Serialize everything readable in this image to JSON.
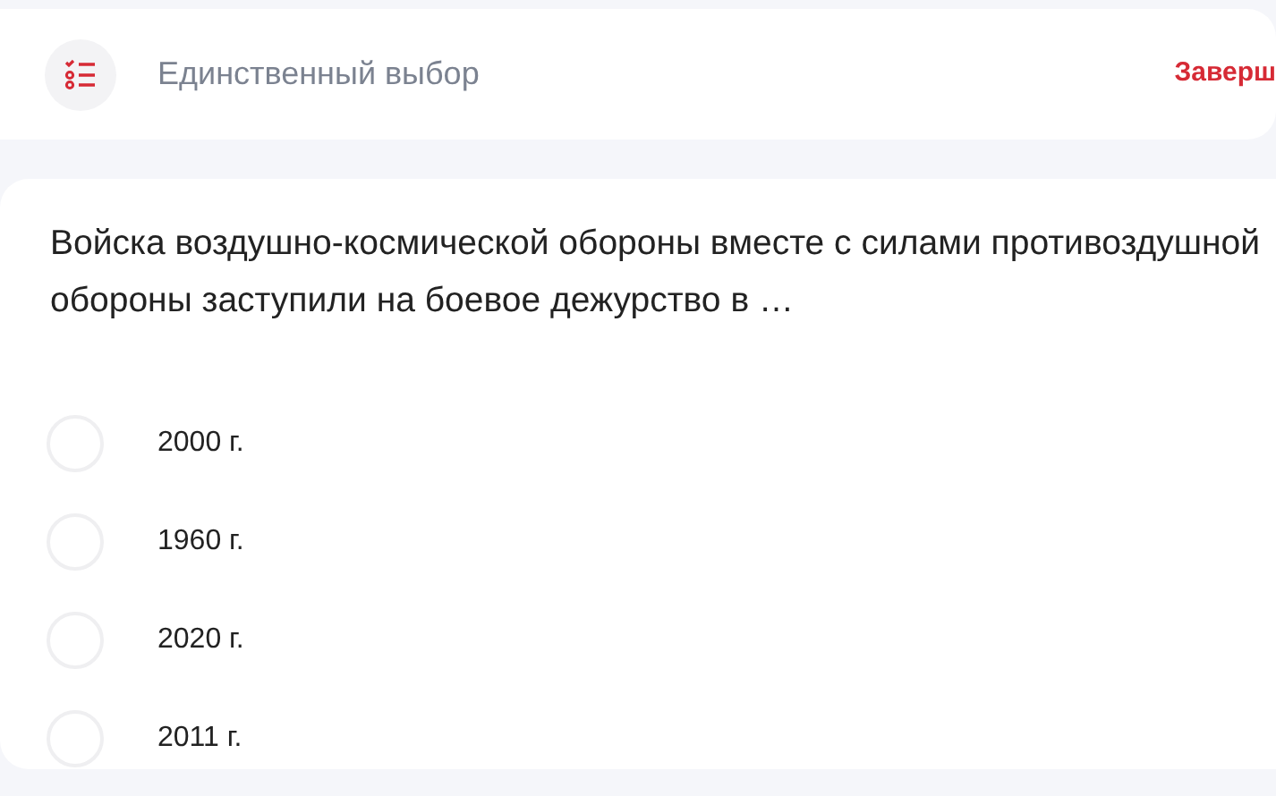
{
  "header": {
    "title": "Единственный выбор",
    "action": "Заверш"
  },
  "question": {
    "text": "Войска воздушно-космической обороны вместе с силами противоздушной обороны заступили на боевое дежурство в …",
    "options": [
      {
        "label": "2000 г.",
        "selected": false
      },
      {
        "label": "1960 г.",
        "selected": false
      },
      {
        "label": "2020 г.",
        "selected": false
      },
      {
        "label": "2011 г.",
        "selected": false
      }
    ]
  }
}
